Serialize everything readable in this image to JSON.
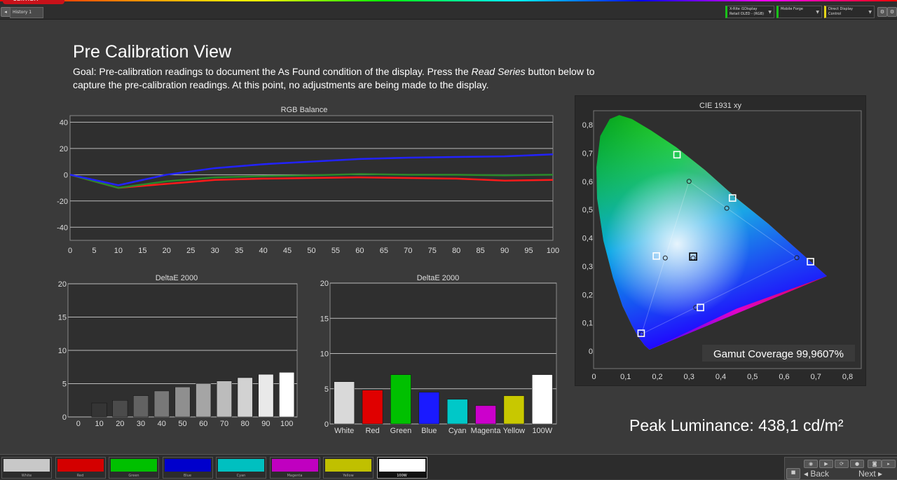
{
  "app": {
    "logo_text": "calman",
    "tab_label": "History 1"
  },
  "devices": [
    {
      "label": "X-Rite i1Display Retail OLED - (RGB)",
      "accent": "#19c319"
    },
    {
      "label": "Mobile Forge",
      "accent": "#19c319"
    },
    {
      "label": "Direct Display Control",
      "accent": "#e6d619"
    }
  ],
  "page": {
    "title": "Pre Calibration View",
    "goal_part1": "Goal: Pre-calibration readings to document the As Found condition of the display. Press the ",
    "goal_italic": "Read Series",
    "goal_part2": " button below to capture the pre-calibration readings. At this point, no adjustments are being made to the display."
  },
  "rgb_chart": {
    "title": "RGB Balance",
    "x_ticks": [
      "0",
      "5",
      "10",
      "15",
      "20",
      "25",
      "30",
      "35",
      "40",
      "45",
      "50",
      "55",
      "60",
      "65",
      "70",
      "75",
      "80",
      "85",
      "90",
      "95",
      "100"
    ],
    "y_ticks": [
      "40",
      "20",
      "0",
      "-20",
      "-40"
    ]
  },
  "delta_gray": {
    "title": "DeltaE 2000",
    "x_ticks": [
      "0",
      "10",
      "20",
      "30",
      "40",
      "50",
      "60",
      "70",
      "80",
      "90",
      "100"
    ],
    "y_ticks": [
      "20",
      "15",
      "10",
      "5",
      "0"
    ]
  },
  "delta_color": {
    "title": "DeltaE 2000",
    "categories": [
      "White",
      "Red",
      "Green",
      "Blue",
      "Cyan",
      "Magenta",
      "Yellow",
      "100W"
    ],
    "y_ticks": [
      "20",
      "15",
      "10",
      "5",
      "0"
    ]
  },
  "cie": {
    "title": "CIE 1931 xy",
    "x_ticks": [
      "0",
      "0,1",
      "0,2",
      "0,3",
      "0,4",
      "0,5",
      "0,6",
      "0,7",
      "0,8"
    ],
    "y_ticks": [
      "0",
      "0,1",
      "0,2",
      "0,3",
      "0,4",
      "0,5",
      "0,6",
      "0,7",
      "0,8"
    ],
    "gamut_label": "Gamut Coverage 99,9607%"
  },
  "peak_luminance": "Peak Luminance: 438,1 cd/m²",
  "chart_data": [
    {
      "type": "line",
      "title": "RGB Balance",
      "xlim": [
        0,
        100
      ],
      "ylim": [
        -50,
        45
      ],
      "x": [
        0,
        10,
        20,
        30,
        40,
        50,
        60,
        70,
        80,
        90,
        100
      ],
      "series": [
        {
          "color": "#ff1a1a",
          "values": [
            0,
            -10,
            -7,
            -4,
            -3,
            -2.5,
            -2,
            -2.5,
            -3,
            -4.5,
            -4
          ]
        },
        {
          "color": "#2a8a2a",
          "values": [
            0,
            -10,
            -5,
            -2,
            -1,
            -0.5,
            0.5,
            0,
            0,
            -0.5,
            0
          ]
        },
        {
          "color": "#2222ff",
          "values": [
            0,
            -8,
            0,
            5,
            8,
            10,
            12,
            13,
            13.5,
            14,
            15.5
          ]
        }
      ]
    },
    {
      "type": "bar",
      "title": "DeltaE 2000",
      "categories": [
        "0",
        "10",
        "20",
        "30",
        "40",
        "50",
        "60",
        "70",
        "80",
        "90",
        "100"
      ],
      "values": [
        0,
        2.1,
        2.5,
        3.2,
        3.9,
        4.5,
        5.0,
        5.4,
        5.9,
        6.4,
        6.7
      ],
      "ylim": [
        0,
        20
      ]
    },
    {
      "type": "bar",
      "title": "DeltaE 2000",
      "categories": [
        "White",
        "Red",
        "Green",
        "Blue",
        "Cyan",
        "Magenta",
        "Yellow",
        "100W"
      ],
      "values": [
        6.0,
        4.8,
        7.0,
        4.5,
        3.5,
        2.6,
        4.0,
        7.0
      ],
      "colors": [
        "#d9d9d9",
        "#e00000",
        "#00c000",
        "#1a1aff",
        "#00c8c8",
        "#cc00cc",
        "#c8c800",
        "#ffffff"
      ],
      "ylim": [
        0,
        20
      ]
    },
    {
      "type": "scatter",
      "title": "CIE 1931 xy",
      "xlim": [
        0,
        0.8
      ],
      "ylim": [
        0,
        0.8
      ],
      "targets": [
        {
          "x": 0.64,
          "y": 0.33
        },
        {
          "x": 0.3,
          "y": 0.6
        },
        {
          "x": 0.15,
          "y": 0.06
        },
        {
          "x": 0.225,
          "y": 0.329
        },
        {
          "x": 0.321,
          "y": 0.154
        },
        {
          "x": 0.419,
          "y": 0.505
        },
        {
          "x": 0.3127,
          "y": 0.329
        }
      ],
      "measured": [
        {
          "x": 0.683,
          "y": 0.316
        },
        {
          "x": 0.262,
          "y": 0.694
        },
        {
          "x": 0.149,
          "y": 0.063
        },
        {
          "x": 0.197,
          "y": 0.336
        },
        {
          "x": 0.336,
          "y": 0.154
        },
        {
          "x": 0.437,
          "y": 0.541
        },
        {
          "x": 0.313,
          "y": 0.334
        }
      ]
    }
  ],
  "swatches": [
    {
      "label": "White",
      "color": "#c8c8c8"
    },
    {
      "label": "Red",
      "color": "#d40000"
    },
    {
      "label": "Green",
      "color": "#00c000"
    },
    {
      "label": "Blue",
      "color": "#0000cc"
    },
    {
      "label": "Cyan",
      "color": "#00c0c0"
    },
    {
      "label": "Magenta",
      "color": "#c000c0"
    },
    {
      "label": "Yellow",
      "color": "#c0c000"
    },
    {
      "label": "100W",
      "color": "#ffffff"
    }
  ],
  "nav": {
    "back": "Back",
    "next": "Next"
  }
}
